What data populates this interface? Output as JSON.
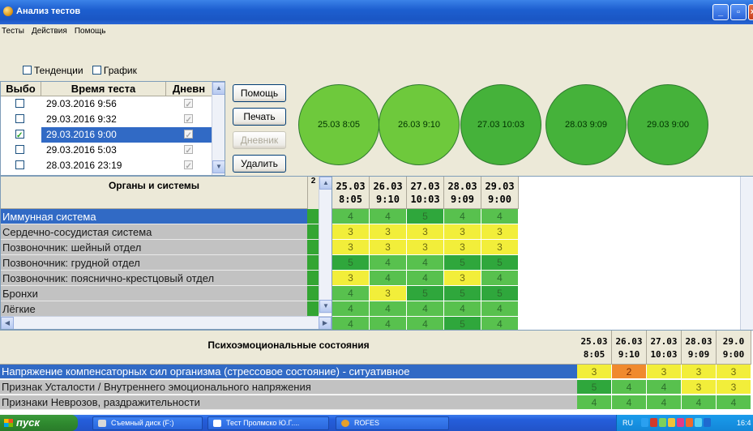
{
  "window": {
    "title": "Анализ тестов"
  },
  "menu": [
    "Тесты",
    "Действия",
    "Помощь"
  ],
  "options": [
    {
      "label": "Тенденции",
      "checked": false
    },
    {
      "label": "График",
      "checked": false
    }
  ],
  "tests": {
    "headers": [
      "Выбо",
      "Время теста",
      "Дневн"
    ],
    "rows": [
      {
        "checked": false,
        "time": "29.03.2016 9:56",
        "diary": true
      },
      {
        "checked": false,
        "time": "29.03.2016 9:32",
        "diary": true
      },
      {
        "checked": true,
        "time": "29.03.2016 9:00",
        "diary": true,
        "selected": true
      },
      {
        "checked": false,
        "time": "29.03.2016 5:03",
        "diary": true
      },
      {
        "checked": false,
        "time": "28.03.2016 23:19",
        "diary": true
      }
    ]
  },
  "buttons": {
    "help": "Помощь",
    "print": "Печать",
    "diary": "Дневник",
    "delete": "Удалить"
  },
  "circles": [
    {
      "label": "25.03 8:05",
      "color": "#6ec93c"
    },
    {
      "label": "26.03 9:10",
      "color": "#6ec93c"
    },
    {
      "label": "27.03 10:03",
      "color": "#45b23a"
    },
    {
      "label": "28.03 9:09",
      "color": "#45b23a"
    },
    {
      "label": "29.03 9:00",
      "color": "#45b23a"
    }
  ],
  "organs": {
    "header": "Органы и системы",
    "side_header": "2",
    "rows": [
      "Иммунная система",
      "Сердечно-сосудистая система",
      "Позвоночник: шейный отдел",
      "Позвоночник: грудной отдел",
      "Позвоночник: пояснично-крестцовый отдел",
      "Бронхи",
      "Лёгкие"
    ]
  },
  "grid": {
    "headers": [
      [
        "25.03",
        "8:05"
      ],
      [
        "26.03",
        "9:10"
      ],
      [
        "27.03",
        "10:03"
      ],
      [
        "28.03",
        "9:09"
      ],
      [
        "29.03",
        "9:00"
      ]
    ],
    "rows": [
      [
        "4",
        "4",
        "5",
        "4",
        "4"
      ],
      [
        "3",
        "3",
        "3",
        "3",
        "3"
      ],
      [
        "3",
        "3",
        "3",
        "3",
        "3"
      ],
      [
        "5",
        "4",
        "4",
        "5",
        "5"
      ],
      [
        "3",
        "4",
        "4",
        "3",
        "4"
      ],
      [
        "4",
        "3",
        "5",
        "5",
        "5"
      ],
      [
        "4",
        "4",
        "4",
        "4",
        "4"
      ],
      [
        "4",
        "4",
        "4",
        "5",
        "4"
      ]
    ]
  },
  "psycho": {
    "header": "Психоэмоциональные состояния",
    "headers": [
      [
        "25.03",
        "8:05"
      ],
      [
        "26.03",
        "9:10"
      ],
      [
        "27.03",
        "10:03"
      ],
      [
        "28.03",
        "9:09"
      ],
      [
        "29.0",
        "9:00"
      ]
    ],
    "rows": [
      {
        "label": "Напряжение компенсаторных сил организма (стрессовое состояние) - ситуативное",
        "values": [
          "3",
          "2",
          "3",
          "3",
          "3"
        ]
      },
      {
        "label": "Признак Усталости / Внутреннего эмоционального напряжения",
        "values": [
          "5",
          "4",
          "4",
          "3",
          "3"
        ]
      },
      {
        "label": "Признаки Неврозов, раздражительности",
        "values": [
          "4",
          "4",
          "4",
          "4",
          "4"
        ]
      }
    ]
  },
  "score_colors": {
    "2": "#f08a2e",
    "3": "#f2ee3a",
    "4": "#58c14e",
    "5": "#2fa73c"
  },
  "taskbar": {
    "start": "пуск",
    "tasks": [
      "Съемный диск (F:)",
      "Тест Пролмско Ю.Г....",
      "ROFES"
    ],
    "lang": "RU",
    "clock": "16:4"
  }
}
